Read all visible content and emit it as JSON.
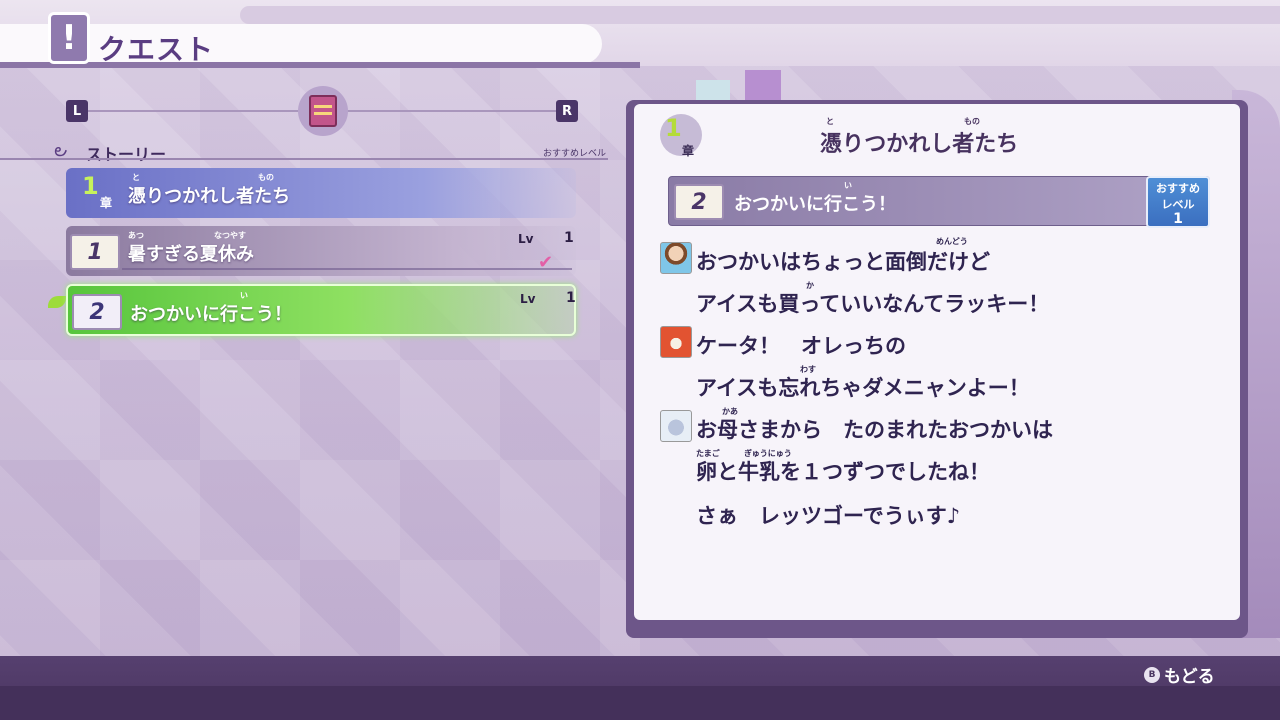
{
  "header": {
    "title": "クエスト",
    "icon": "exclamation-icon"
  },
  "nav": {
    "left_button": "L",
    "right_button": "R",
    "center_icon": "book-icon"
  },
  "story": {
    "label": "ストーリー",
    "recommended_level_label": "おすすめレベル"
  },
  "chapter": {
    "number": "1",
    "kanji": "章",
    "title": "憑りつかれし者たち",
    "furigana_to": "と",
    "furigana_mono": "もの"
  },
  "quests": [
    {
      "number": "1",
      "title": "暑すぎる夏休み",
      "furigana_atsu": "あつ",
      "furigana_natsuyasu": "なつやす",
      "lv_label": "Lv",
      "lv_value": "1",
      "completed": true
    },
    {
      "number": "2",
      "title": "おつかいに行こう！",
      "furigana_i": "い",
      "lv_label": "Lv",
      "lv_value": "1",
      "selected": true
    }
  ],
  "detail": {
    "chapter_number": "1",
    "chapter_kanji": "章",
    "chapter_title": "憑りつかれし者たち",
    "furigana_to": "と",
    "furigana_mono": "もの",
    "quest_number": "2",
    "quest_title": "おつかいに行こう！",
    "quest_furigana_i": "い",
    "recommended": {
      "line1": "おすすめ",
      "line2": "レベル",
      "value": "1"
    },
    "dialog": [
      {
        "text": "おつかいはちょっと面倒だけど",
        "speaker_icon": "keita-avatar-icon"
      },
      {
        "text": "アイスも買っていいなんてラッキー！"
      },
      {
        "text": "ケータ！　オレっちの",
        "speaker_icon": "jibanyan-avatar-icon"
      },
      {
        "text": "アイスも忘れちゃダメニャンよー！"
      },
      {
        "text": "お母さまから　たのまれたおつかいは",
        "speaker_icon": "whisper-avatar-icon"
      },
      {
        "text": "卵と牛乳を１つずつでしたね！"
      },
      {
        "text": "さぁ　レッツゴーでうぃす♪"
      }
    ],
    "furigana": {
      "mendou": "めんどう",
      "ka": "か",
      "wasu": "わす",
      "kaa": "かあ",
      "tamago": "たまご",
      "gyuunyuu": "ぎゅうにゅう"
    }
  },
  "footer": {
    "back_button_glyph": "B",
    "back_label": "もどる"
  },
  "colors": {
    "accent": "#5a3d82",
    "selected_green": "#57c53c",
    "chapter_blue": "#6a70c6",
    "bottom_bar": "#56406f"
  }
}
